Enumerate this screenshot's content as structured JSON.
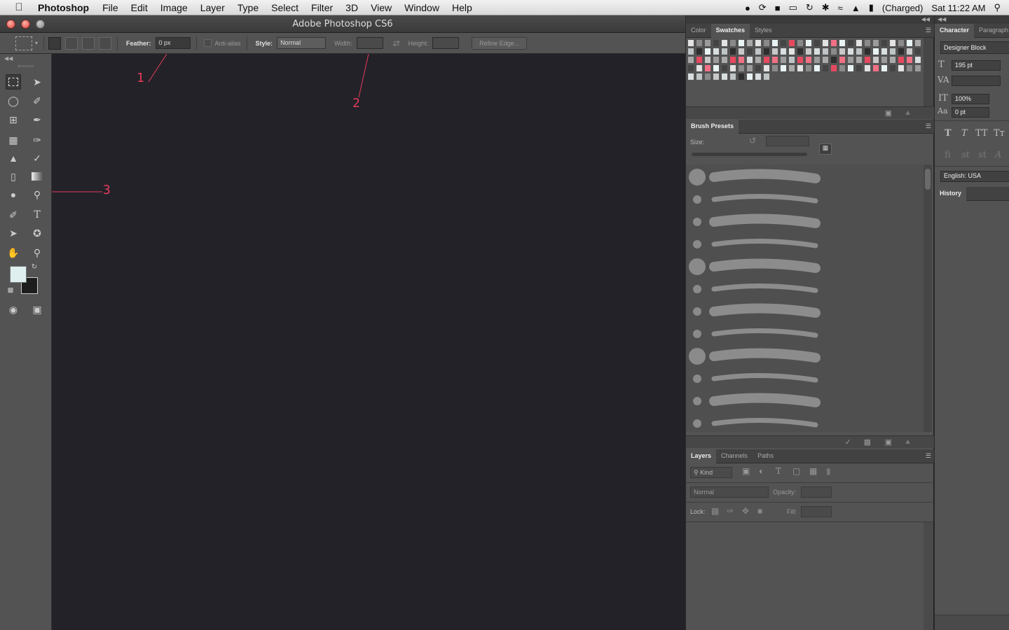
{
  "menubar": {
    "apple": "",
    "app_name": "Photoshop",
    "items": [
      "File",
      "Edit",
      "Image",
      "Layer",
      "Type",
      "Select",
      "Filter",
      "3D",
      "View",
      "Window",
      "Help"
    ],
    "battery": "(Charged)",
    "clock": "Sat 11:22 AM"
  },
  "window": {
    "title": "Adobe Photoshop CS6"
  },
  "options": {
    "feather_label": "Feather:",
    "feather_value": "0 px",
    "antialias_label": "Anti-alias",
    "style_label": "Style:",
    "style_value": "Normal",
    "width_label": "Width:",
    "height_label": "Height:",
    "refine_label": "Refine Edge..."
  },
  "annotations": {
    "a1": "1",
    "a2": "2",
    "a3": "3"
  },
  "swatch_panel": {
    "tabs": [
      "Color",
      "Swatches",
      "Styles"
    ]
  },
  "brush_panel": {
    "tab": "Brush Presets",
    "size_label": "Size:"
  },
  "layers_panel": {
    "tabs": [
      "Layers",
      "Channels",
      "Paths"
    ],
    "kind": "Kind",
    "blend": "Normal",
    "opacity_label": "Opacity:",
    "lock_label": "Lock:",
    "fill_label": "Fill:"
  },
  "character_panel": {
    "tabs": [
      "Character",
      "Paragraph"
    ],
    "font": "Designer Block",
    "size": "195 pt",
    "scale": "100%",
    "baseline": "0 pt",
    "language": "English: USA",
    "history_tab": "History"
  },
  "colors": {
    "accent": "#e63b5d",
    "panel": "#535353",
    "canvas": "#232228"
  }
}
